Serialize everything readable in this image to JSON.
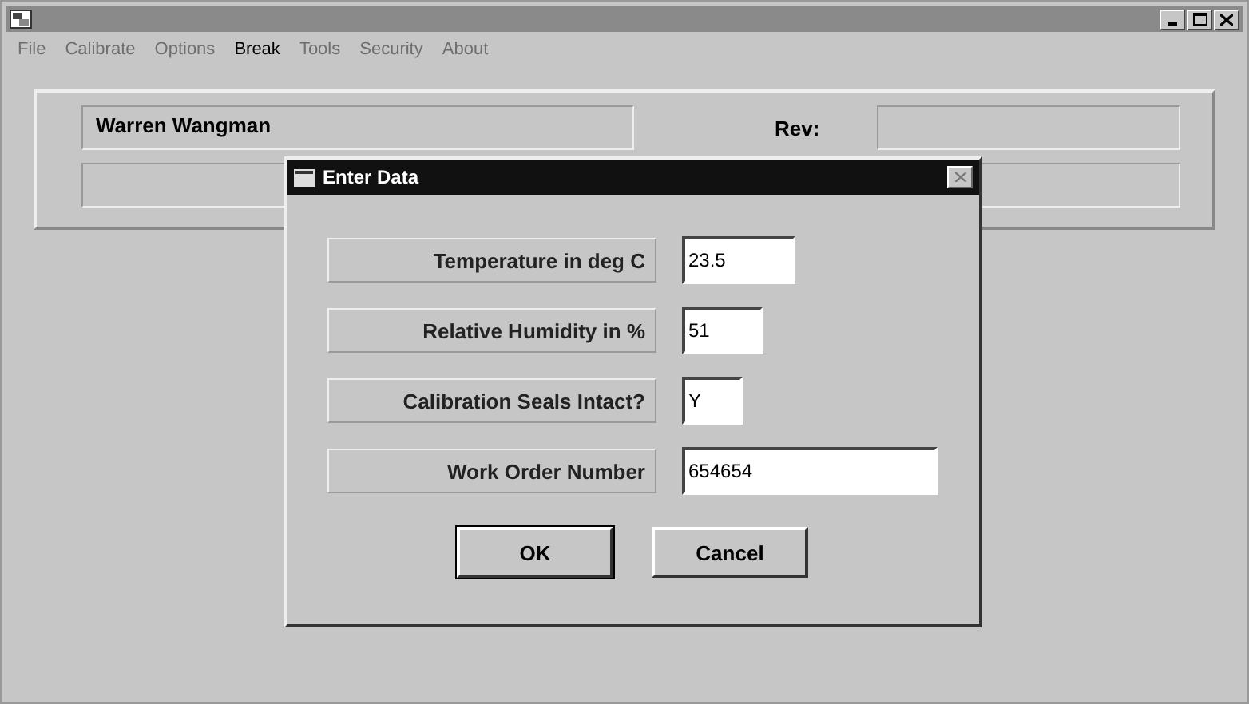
{
  "menu": [
    {
      "label": "File",
      "disabled": true
    },
    {
      "label": "Calibrate",
      "disabled": true
    },
    {
      "label": "Options",
      "disabled": true
    },
    {
      "label": "Break",
      "disabled": false
    },
    {
      "label": "Tools",
      "disabled": true
    },
    {
      "label": "Security",
      "disabled": true
    },
    {
      "label": "About",
      "disabled": true
    }
  ],
  "header": {
    "name": "Warren Wangman",
    "rev_label": "Rev:"
  },
  "dialog": {
    "title": "Enter Data",
    "fields": [
      {
        "label": "Temperature in deg C",
        "value": "23.5"
      },
      {
        "label": "Relative Humidity in %",
        "value": "51"
      },
      {
        "label": "Calibration Seals Intact?",
        "value": "Y"
      },
      {
        "label": "Work Order Number",
        "value": "654654"
      }
    ],
    "buttons": [
      {
        "label": "OK",
        "default": true
      },
      {
        "label": "Cancel",
        "default": false
      }
    ]
  }
}
